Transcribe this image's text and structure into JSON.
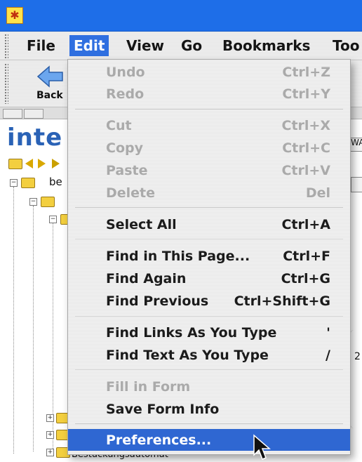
{
  "menubar": {
    "items": [
      "File",
      "Edit",
      "View",
      "Go",
      "Bookmarks",
      "Too"
    ]
  },
  "toolbar": {
    "back_label": "Back"
  },
  "page": {
    "brand_partial": "inte",
    "tree_item_partial": "be",
    "bottom_partial": "Bestückungsautomat",
    "right_partial": "WA",
    "right_small": "2"
  },
  "edit_menu": {
    "items": [
      {
        "label": "Undo",
        "shortcut": "Ctrl+Z",
        "enabled": false
      },
      {
        "label": "Redo",
        "shortcut": "Ctrl+Y",
        "enabled": false
      },
      {
        "label": "Cut",
        "shortcut": "Ctrl+X",
        "enabled": false
      },
      {
        "label": "Copy",
        "shortcut": "Ctrl+C",
        "enabled": false
      },
      {
        "label": "Paste",
        "shortcut": "Ctrl+V",
        "enabled": false
      },
      {
        "label": "Delete",
        "shortcut": "Del",
        "enabled": false
      },
      {
        "label": "Select All",
        "shortcut": "Ctrl+A",
        "enabled": true
      },
      {
        "label": "Find in This Page...",
        "shortcut": "Ctrl+F",
        "enabled": true
      },
      {
        "label": "Find Again",
        "shortcut": "Ctrl+G",
        "enabled": true
      },
      {
        "label": "Find Previous",
        "shortcut": "Ctrl+Shift+G",
        "enabled": true
      },
      {
        "label": "Find Links As You Type",
        "shortcut": "'",
        "enabled": true
      },
      {
        "label": "Find Text As You Type",
        "shortcut": "/",
        "enabled": true
      },
      {
        "label": "Fill in Form",
        "shortcut": "",
        "enabled": false
      },
      {
        "label": "Save Form Info",
        "shortcut": "",
        "enabled": true
      },
      {
        "label": "Preferences...",
        "shortcut": "",
        "enabled": true,
        "highlighted": true
      }
    ]
  },
  "colors": {
    "titlebar": "#1e6ee8",
    "highlight": "#2f67d2",
    "disabled_text": "#aaaaaa"
  }
}
